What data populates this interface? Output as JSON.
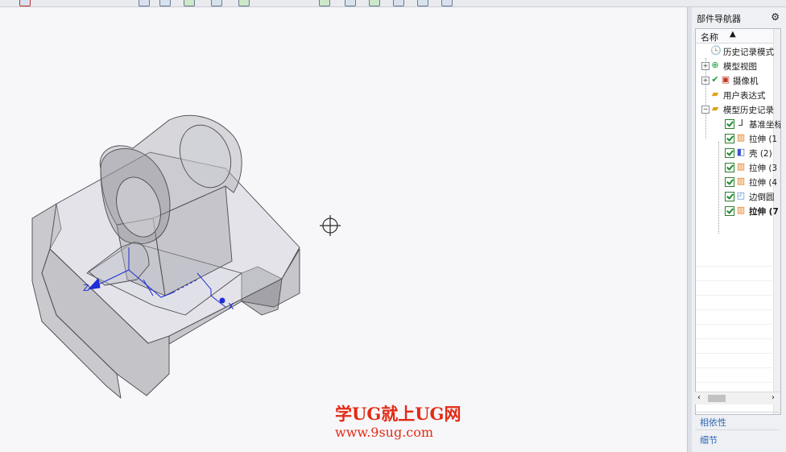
{
  "watermark": {
    "line1": "学UG就上UG网",
    "line2": "www.9sug.com"
  },
  "viewport": {
    "axis_labels": {
      "z": "Z",
      "x": "X"
    }
  },
  "navigator": {
    "title": "部件导航器",
    "column_header": "名称",
    "items": [
      {
        "label": "历史记录模式",
        "icon": "clock-icon",
        "indent": 0
      },
      {
        "label": "模型视图",
        "icon": "model-views-icon",
        "indent": 0,
        "expander": "+"
      },
      {
        "label": "摄像机",
        "icon": "camera-icon",
        "indent": 0,
        "expander": "+",
        "checked_mark": true
      },
      {
        "label": "用户表达式",
        "icon": "folder-icon",
        "indent": 0
      },
      {
        "label": "模型历史记录",
        "icon": "folder-open-icon",
        "indent": 0,
        "expander": "−"
      },
      {
        "label": "基准坐标",
        "icon": "datum-csys-icon",
        "indent": 1
      },
      {
        "label": "拉伸 (1",
        "icon": "extrude-icon",
        "indent": 1
      },
      {
        "label": "壳 (2)",
        "icon": "shell-icon",
        "indent": 1
      },
      {
        "label": "拉伸 (3",
        "icon": "extrude-icon",
        "indent": 1
      },
      {
        "label": "拉伸 (4",
        "icon": "extrude-icon",
        "indent": 1
      },
      {
        "label": "边倒圆",
        "icon": "edge-blend-icon",
        "indent": 1
      },
      {
        "label": "拉伸 (7",
        "icon": "extrude-icon",
        "indent": 1,
        "bold": true
      }
    ],
    "panels": {
      "dependencies": "相依性",
      "details": "细节"
    }
  }
}
